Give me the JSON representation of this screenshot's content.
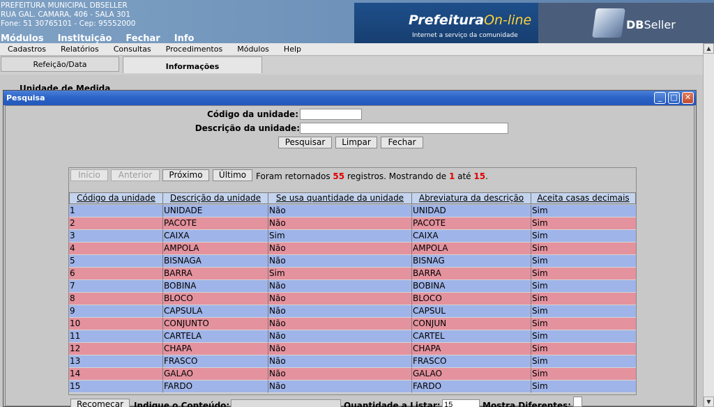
{
  "header": {
    "address_lines": [
      "PREFEITURA MUNICIPAL DBSELLER",
      "RUA GAL. CAMARA, 406 - SALA 301",
      "Fone: 51 30765101 -  Cep: 95552000"
    ],
    "logo_main": "Prefeitura",
    "logo_online": "On-line",
    "logo_sub": "Internet a serviço da comunidade",
    "brand_db": "DB",
    "brand_seller": "Seller",
    "top_menu": [
      "Módulos",
      "Instituição",
      "Fechar",
      "Info"
    ]
  },
  "menubar": [
    "Cadastros",
    "Relatórios",
    "Consultas",
    "Procedimentos",
    "Módulos",
    "Help"
  ],
  "tabs": {
    "refeicao": "Refeição/Data",
    "informacoes": "Informações"
  },
  "background_title": "Unidade de Medida",
  "window": {
    "title": "Pesquisa",
    "min": "_",
    "max": "□",
    "close": "✕"
  },
  "form": {
    "codigo_label": "Código da unidade:",
    "codigo_value": "",
    "descricao_label": "Descrição da unidade:",
    "descricao_value": "",
    "pesquisar": "Pesquisar",
    "limpar": "Limpar",
    "fechar": "Fechar"
  },
  "nav": {
    "inicio": "Início",
    "anterior": "Anterior",
    "proximo": "Próximo",
    "ultimo": "Último",
    "info_prefix": "Foram retornados ",
    "total": "55",
    "info_mid": " registros. Mostrando de ",
    "from": "1",
    "info_ate": " até ",
    "to": "15",
    "info_end": "."
  },
  "table": {
    "headers": [
      "Código da unidade",
      "Descrição da unidade",
      "Se usa quantidade da unidade",
      "Abreviatura da descrição",
      "Aceita casas decimais"
    ],
    "rows": [
      [
        "1",
        "UNIDADE",
        "Não",
        "UNIDAD",
        "Sim"
      ],
      [
        "2",
        "PACOTE",
        "Não",
        "PACOTE",
        "Sim"
      ],
      [
        "3",
        "CAIXA",
        "Sim",
        "CAIXA",
        "Sim"
      ],
      [
        "4",
        "AMPOLA",
        "Não",
        "AMPOLA",
        "Sim"
      ],
      [
        "5",
        "BISNAGA",
        "Não",
        "BISNAG",
        "Sim"
      ],
      [
        "6",
        "BARRA",
        "Sim",
        "BARRA",
        "Sim"
      ],
      [
        "7",
        "BOBINA",
        "Não",
        "BOBINA",
        "Sim"
      ],
      [
        "8",
        "BLOCO",
        "Não",
        "BLOCO",
        "Sim"
      ],
      [
        "9",
        "CAPSULA",
        "Não",
        "CAPSUL",
        "Sim"
      ],
      [
        "10",
        "CONJUNTO",
        "Não",
        "CONJUN",
        "Sim"
      ],
      [
        "11",
        "CARTELA",
        "Não",
        "CARTEL",
        "Sim"
      ],
      [
        "12",
        "CHAPA",
        "Não",
        "CHAPA",
        "Sim"
      ],
      [
        "13",
        "FRASCO",
        "Não",
        "FRASCO",
        "Sim"
      ],
      [
        "14",
        "GALAO",
        "Não",
        "GALAO",
        "Sim"
      ],
      [
        "15",
        "FARDO",
        "Não",
        "FARDO",
        "Sim"
      ]
    ]
  },
  "footer": {
    "recomecar": "Recomeçar",
    "indique_label": "Indique o Conteúdo:",
    "indique_value": "",
    "quantidade_label": "Quantidade a Listar:",
    "quantidade_value": "15",
    "mostra_label": "Mostra Diferentes:"
  },
  "colors": {
    "row_odd": "#9fb4e8",
    "row_even": "#e4929e",
    "highlight": "#e00000",
    "titlebar": "#2a62c6"
  }
}
